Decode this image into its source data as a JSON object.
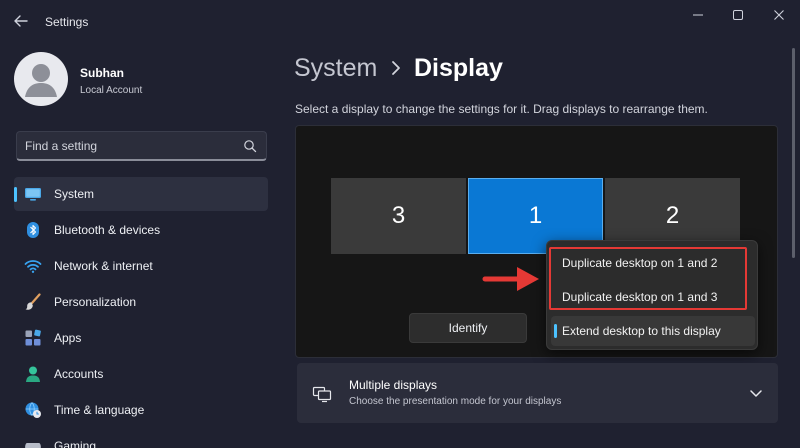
{
  "window": {
    "title": "Settings",
    "controls": {
      "minimize": "minimize-icon",
      "maximize": "maximize-icon",
      "close": "close-icon"
    }
  },
  "profile": {
    "name": "Subhan",
    "account_type": "Local Account"
  },
  "search": {
    "placeholder": "Find a setting"
  },
  "sidebar": {
    "items": [
      {
        "label": "System",
        "icon": "monitor-icon",
        "active": true
      },
      {
        "label": "Bluetooth & devices",
        "icon": "bluetooth-icon",
        "active": false
      },
      {
        "label": "Network & internet",
        "icon": "wifi-icon",
        "active": false
      },
      {
        "label": "Personalization",
        "icon": "brush-icon",
        "active": false
      },
      {
        "label": "Apps",
        "icon": "apps-icon",
        "active": false
      },
      {
        "label": "Accounts",
        "icon": "person-icon",
        "active": false
      },
      {
        "label": "Time & language",
        "icon": "globe-clock-icon",
        "active": false
      },
      {
        "label": "Gaming",
        "icon": "gamepad-icon",
        "active": false
      }
    ]
  },
  "breadcrumb": {
    "parent": "System",
    "current": "Display"
  },
  "main": {
    "instruction": "Select a display to change the settings for it. Drag displays to rearrange them.",
    "monitors": [
      {
        "label": "3",
        "selected": false
      },
      {
        "label": "1",
        "selected": true
      },
      {
        "label": "2",
        "selected": false
      }
    ],
    "identify_label": "Identify",
    "dropdown": {
      "options": [
        {
          "label": "Duplicate desktop on 1 and 2",
          "selected": false
        },
        {
          "label": "Duplicate desktop on 1 and 3",
          "selected": false
        },
        {
          "label": "Extend desktop to this display",
          "selected": true
        }
      ]
    },
    "multiple_displays": {
      "title": "Multiple displays",
      "subtitle": "Choose the presentation mode for your displays"
    }
  },
  "colors": {
    "background": "#1f2130",
    "accent": "#4cc2ff",
    "selected_monitor": "#0a78d4",
    "annotation_red": "#e53935"
  }
}
